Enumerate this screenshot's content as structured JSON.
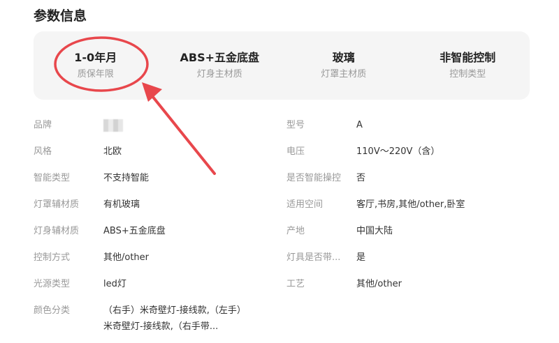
{
  "section_title": "参数信息",
  "summary": [
    {
      "value": "1-0年月",
      "key": "质保年限"
    },
    {
      "value": "ABS+五金底盘",
      "key": "灯身主材质"
    },
    {
      "value": "玻璃",
      "key": "灯罩主材质"
    },
    {
      "value": "非智能控制",
      "key": "控制类型"
    }
  ],
  "specs_left": [
    {
      "label": "品牌",
      "value": ""
    },
    {
      "label": "风格",
      "value": "北欧"
    },
    {
      "label": "智能类型",
      "value": "不支持智能"
    },
    {
      "label": "灯罩辅材质",
      "value": "有机玻璃"
    },
    {
      "label": "灯身辅材质",
      "value": "ABS+五金底盘"
    },
    {
      "label": "控制方式",
      "value": "其他/other"
    },
    {
      "label": "光源类型",
      "value": "led灯"
    },
    {
      "label": "颜色分类",
      "value": "（右手）米奇壁灯-接线款,（左手）米奇壁灯-接线款,（右手带..."
    }
  ],
  "specs_right": [
    {
      "label": "型号",
      "value": "A"
    },
    {
      "label": "电压",
      "value": "110V～220V（含）"
    },
    {
      "label": "是否智能操控",
      "value": "否"
    },
    {
      "label": "适用空间",
      "value": "客厅,书房,其他/other,卧室"
    },
    {
      "label": "产地",
      "value": "中国大陆"
    },
    {
      "label": "灯具是否带...",
      "value": "是"
    },
    {
      "label": "工艺",
      "value": "其他/other"
    }
  ],
  "colors": {
    "annotation_red": "#e8474c",
    "summary_bg": "#f5f5f5",
    "label_gray": "#999999"
  }
}
